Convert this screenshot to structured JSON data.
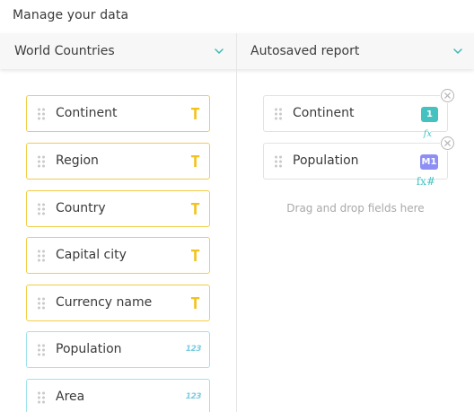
{
  "title": "Manage your data",
  "left_dropdown": {
    "label": "World Countries",
    "icon": "chevron-down-icon"
  },
  "right_dropdown": {
    "label": "Autosaved report",
    "icon": "chevron-down-icon"
  },
  "colors": {
    "text_field_border": "#f2cd4a",
    "text_type_icon": "#f2c21b",
    "number_field_border": "#9fe1ef",
    "number_type_icon": "#7ccbe0",
    "accent_teal": "#45c2c0",
    "accent_violet": "#8e8ff5"
  },
  "available_fields": [
    {
      "label": "Continent",
      "type": "text",
      "type_icon": "T"
    },
    {
      "label": "Region",
      "type": "text",
      "type_icon": "T"
    },
    {
      "label": "Country",
      "type": "text",
      "type_icon": "T"
    },
    {
      "label": "Capital city",
      "type": "text",
      "type_icon": "T"
    },
    {
      "label": "Currency name",
      "type": "text",
      "type_icon": "T"
    },
    {
      "label": "Population",
      "type": "number",
      "type_icon": "123"
    },
    {
      "label": "Area",
      "type": "number",
      "type_icon": "123"
    }
  ],
  "report_fields": [
    {
      "label": "Continent",
      "badge": "1",
      "formula": "fx"
    },
    {
      "label": "Population",
      "badge": "M1",
      "formula": "fx#"
    }
  ],
  "drop_hint": "Drag and drop fields here"
}
